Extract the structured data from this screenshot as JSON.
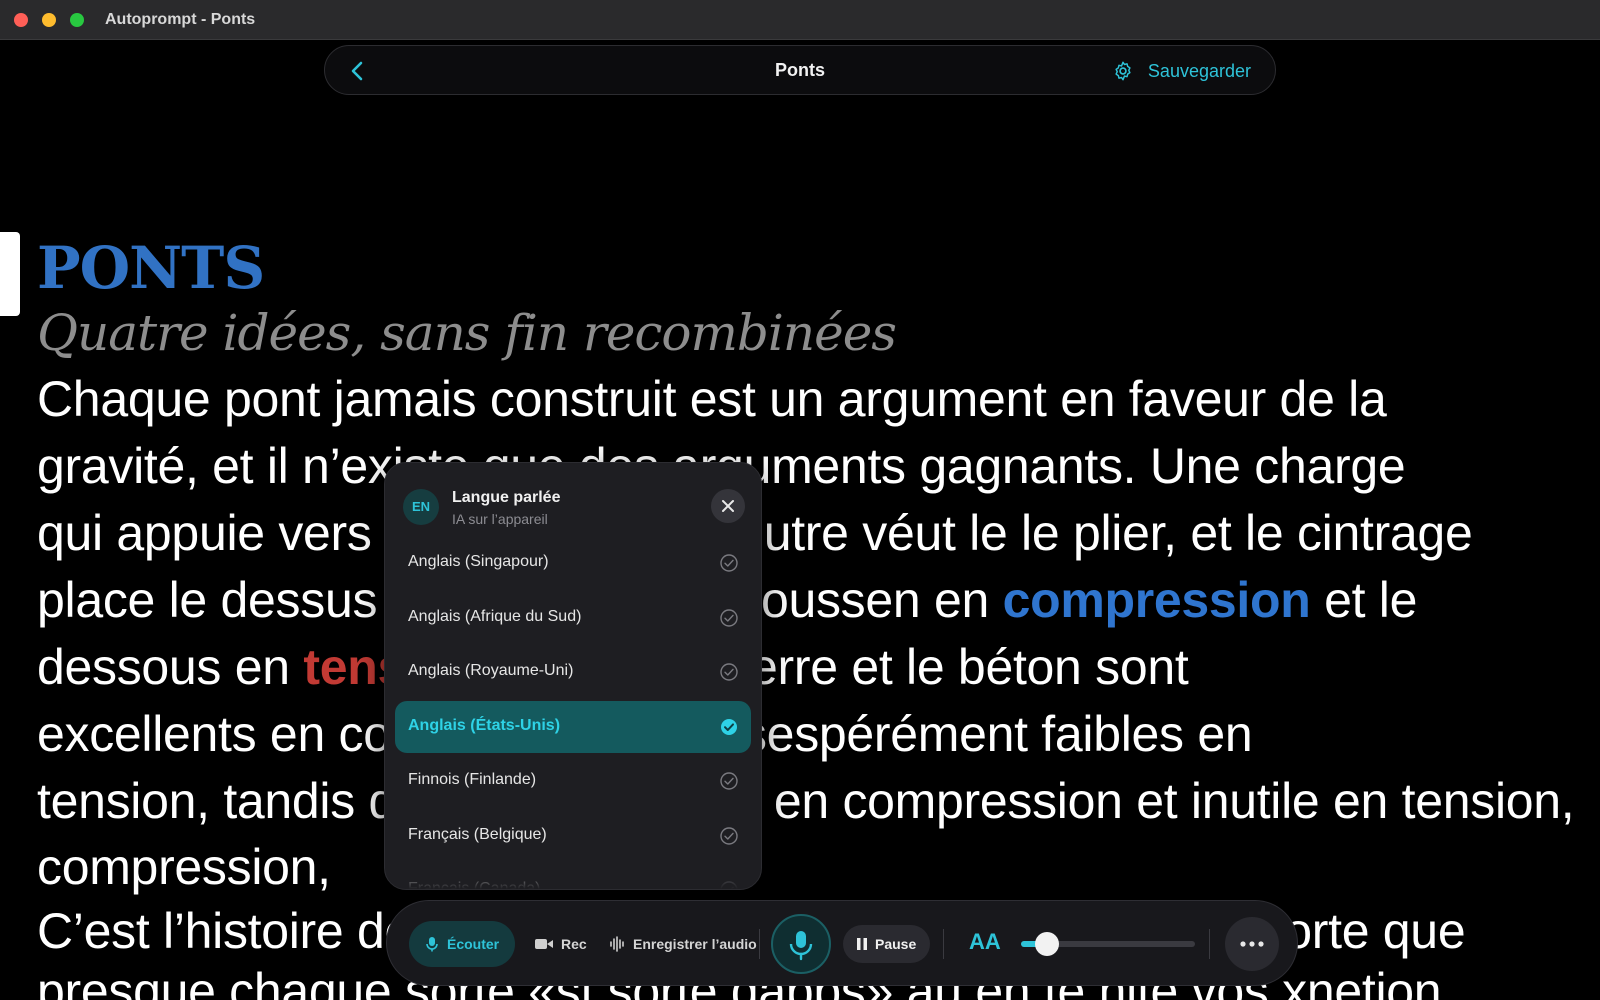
{
  "window": {
    "title": "Autoprompt - Ponts"
  },
  "topbar": {
    "title": "Ponts",
    "save_label": "Sauvegarder"
  },
  "document": {
    "title": "PONTS",
    "subtitle": "Quatre idées, sans fin recombinées",
    "lines": [
      {
        "parts": [
          {
            "text": "Chaque pont jamais construit est un argument en faveur de la"
          }
        ]
      },
      {
        "parts": [
          {
            "text": "gravité, et il n’existe que des arguments gagnants. Une charge"
          }
        ]
      },
      {
        "parts": [
          {
            "text": "qui appuie vers le bas sur une poutre véut le le plier, et le cintrage"
          }
        ]
      },
      {
        "parts": [
          {
            "text": "place le dessus de la poutre en poussen en "
          },
          {
            "text": "compression",
            "style": "blue"
          },
          {
            "text": " et le"
          }
        ]
      },
      {
        "parts": [
          {
            "text": "dessous en "
          },
          {
            "text": "tension",
            "style": "red"
          },
          {
            "text": ". Autant la pierre et le béton sont"
          }
        ]
      },
      {
        "parts": [
          {
            "text": "excellents en compression et désespérément faibles en"
          }
        ]
      },
      {
        "parts": [
          {
            "text": "tension, tandis que l’acier excelle en compression et inutile en tension,"
          }
        ]
      },
      {
        "parts": [
          {
            "text": "compression,"
          }
        ]
      },
      {
        "parts": [
          {
            "text": "C’est l’histoire de nos ponts : chaque pont est conçu de sorte que"
          }
        ]
      },
      {
        "parts": [
          {
            "text": "presque chaque sorte «st sorté dapps» au en te hite vos xnetion"
          }
        ]
      }
    ]
  },
  "language_picker": {
    "badge": "EN",
    "title": "Langue parlée",
    "subtitle": "IA sur l’appareil",
    "options": [
      {
        "label": "Anglais (Singapour)",
        "selected": false
      },
      {
        "label": "Anglais (Afrique du Sud)",
        "selected": false
      },
      {
        "label": "Anglais (Royaume-Uni)",
        "selected": false
      },
      {
        "label": "Anglais (États-Unis)",
        "selected": true
      },
      {
        "label": "Finnois (Finlande)",
        "selected": false
      },
      {
        "label": "Français (Belgique)",
        "selected": false
      },
      {
        "label": "Français (Canada)",
        "selected": false
      }
    ]
  },
  "controls": {
    "listen_label": "Écouter",
    "rec_label": "Rec",
    "record_audio_label": "Enregistrer l’audio",
    "pause_label": "Pause",
    "font_size_label": "AA",
    "font_size_level": 0.15
  },
  "colors": {
    "accent": "#2ec3d8",
    "title_blue": "#3172c4",
    "highlight_blue": "#2f75cf",
    "highlight_red": "#c23a34",
    "selected_bg": "#145a5e"
  },
  "icons": {
    "back": "chevron-left-icon",
    "save": "gear-icon",
    "close": "close-icon",
    "check": "check-circle-icon",
    "listen": "microphone-icon",
    "rec": "video-camera-icon",
    "audio": "waveform-icon",
    "mic": "microphone-icon",
    "pause": "pause-icon",
    "font": "font-size-icon",
    "more": "more-horizontal-icon"
  }
}
